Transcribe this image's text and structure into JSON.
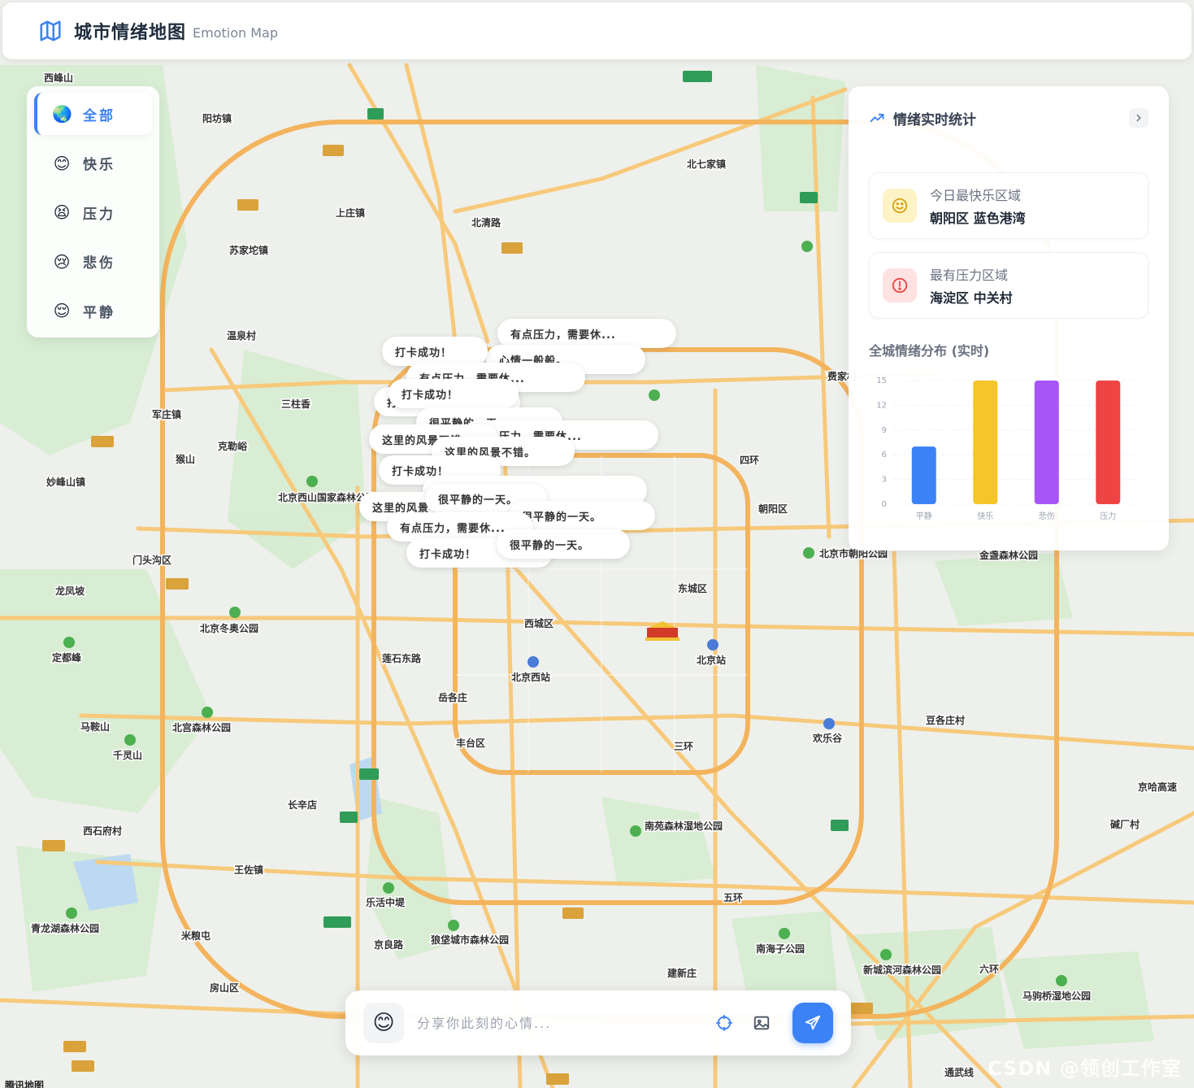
{
  "header": {
    "title": "城市情绪地图",
    "subtitle": "Emotion Map"
  },
  "filters": [
    {
      "emoji": "🌏",
      "label": "全部",
      "active": true
    },
    {
      "emoji": "😊",
      "label": "快乐",
      "active": false
    },
    {
      "emoji": "😫",
      "label": "压力",
      "active": false
    },
    {
      "emoji": "😢",
      "label": "悲伤",
      "active": false
    },
    {
      "emoji": "😌",
      "label": "平静",
      "active": false
    }
  ],
  "stats": {
    "title": "情绪实时统计",
    "happiest": {
      "label": "今日最快乐区域",
      "value": "朝阳区 蓝色港湾"
    },
    "stressed": {
      "label": "最有压力区域",
      "value": "海淀区 中关村"
    },
    "distribution_title": "全城情绪分布 (实时)"
  },
  "chart_data": {
    "type": "bar",
    "categories": [
      "平静",
      "快乐",
      "悲伤",
      "压力"
    ],
    "values": [
      7,
      15,
      15,
      15
    ],
    "colors": [
      "#3b82f6",
      "#f5c52b",
      "#a855f7",
      "#ef4444"
    ],
    "yticks": [
      0,
      3,
      6,
      9,
      12,
      15
    ],
    "ylim": [
      0,
      15
    ],
    "grid": true
  },
  "bubbles": [
    {
      "text": "有点压力，需要休..."
    },
    {
      "text": "心情一般般。"
    },
    {
      "text": "打卡成功！"
    },
    {
      "text": "有点压力，需要休..."
    },
    {
      "text": "打卡成功！"
    },
    {
      "text": "打卡成功！"
    },
    {
      "text": "很平静的一天。"
    },
    {
      "text": "有点压力，需要休..."
    },
    {
      "text": "这里的风景不错。"
    },
    {
      "text": "这里的风景不错。"
    },
    {
      "text": "打卡成功！"
    },
    {
      "text": "今天阳光很好..."
    },
    {
      "text": "这里的风景不错。"
    },
    {
      "text": "很平静的一天。"
    },
    {
      "text": "很平静的一天。"
    },
    {
      "text": "有点压力，需要休..."
    },
    {
      "text": "打卡成功！"
    },
    {
      "text": "很平静的一天。"
    }
  ],
  "input_bar": {
    "emoji": "😊",
    "placeholder": "分享你此刻的心情..."
  },
  "map_labels": [
    {
      "text": "西峰山"
    },
    {
      "text": "阳坊镇"
    },
    {
      "text": "北七家镇"
    },
    {
      "text": "上庄镇"
    },
    {
      "text": "北清路"
    },
    {
      "text": "苏家坨镇"
    },
    {
      "text": "温泉村"
    },
    {
      "text": "三柱香"
    },
    {
      "text": "军庄镇"
    },
    {
      "text": "克勒峪"
    },
    {
      "text": "猴山"
    },
    {
      "text": "妙峰山镇"
    },
    {
      "text": "北京西山国家森林公园"
    },
    {
      "text": "门头沟区"
    },
    {
      "text": "龙凤坡"
    },
    {
      "text": "北京冬奥公园"
    },
    {
      "text": "定都峰"
    },
    {
      "text": "西城区"
    },
    {
      "text": "东城区"
    },
    {
      "text": "朝阳区"
    },
    {
      "text": "北京站"
    },
    {
      "text": "北京西站"
    },
    {
      "text": "莲石东路"
    },
    {
      "text": "岳各庄"
    },
    {
      "text": "丰台区"
    },
    {
      "text": "三环"
    },
    {
      "text": "欢乐谷"
    },
    {
      "text": "豆各庄村"
    },
    {
      "text": "马鞍山"
    },
    {
      "text": "北宫森林公园"
    },
    {
      "text": "千灵山"
    },
    {
      "text": "长辛店"
    },
    {
      "text": "西石府村"
    },
    {
      "text": "王佐镇"
    },
    {
      "text": "南苑森林湿地公园"
    },
    {
      "text": "五环"
    },
    {
      "text": "乐活中堤"
    },
    {
      "text": "青龙湖森林公园"
    },
    {
      "text": "米粮屯"
    },
    {
      "text": "京良路"
    },
    {
      "text": "狼垡城市森林公园"
    },
    {
      "text": "南海子公园"
    },
    {
      "text": "建新庄"
    },
    {
      "text": "房山区"
    },
    {
      "text": "新城滨河森林公园"
    },
    {
      "text": "六环"
    },
    {
      "text": "马驹桥湿地公园"
    },
    {
      "text": "碱厂村"
    },
    {
      "text": "京哈高速"
    },
    {
      "text": "北京市朝阳公园"
    },
    {
      "text": "金盏森林公园"
    },
    {
      "text": "四环"
    },
    {
      "text": "费家村"
    },
    {
      "text": "通武线"
    },
    {
      "text": "腾讯地图"
    }
  ],
  "watermark": "CSDN @领创工作室"
}
